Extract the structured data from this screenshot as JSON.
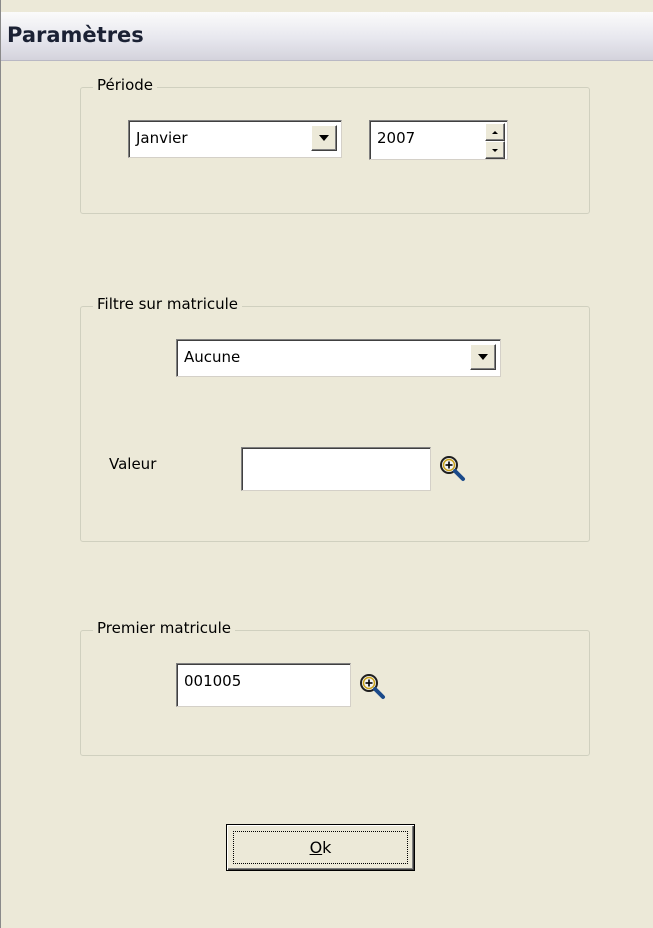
{
  "window": {
    "title": "Paramètres"
  },
  "periode": {
    "legend": "Période",
    "month_value": "Janvier",
    "year_value": "2007"
  },
  "filtre": {
    "legend": "Filtre sur matricule",
    "filter_value": "Aucune",
    "valeur_label": "Valeur",
    "valeur_value": ""
  },
  "premier": {
    "legend": "Premier matricule",
    "matricule_value": "001005"
  },
  "actions": {
    "ok_mnemonic": "O",
    "ok_rest": "k"
  },
  "icons": {
    "lookup": "magnifier-search-icon",
    "dropdown": "chevron-down-icon",
    "spin_up": "spin-up-icon",
    "spin_down": "spin-down-icon"
  }
}
